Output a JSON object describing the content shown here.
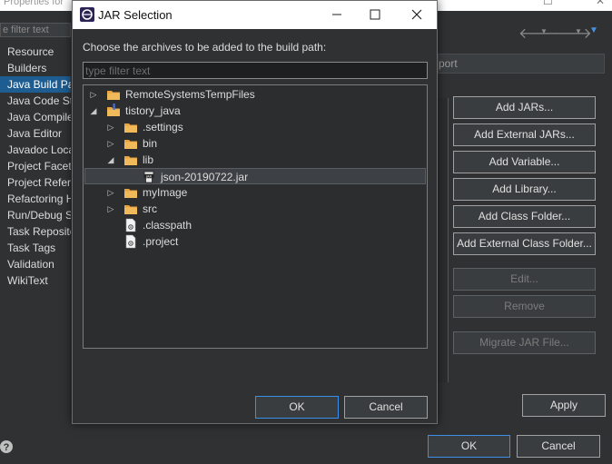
{
  "background": {
    "title": "Properties for",
    "filter_placeholder": "e filter text",
    "tab_stub": "port",
    "categories": [
      {
        "label": "Resource",
        "selected": false
      },
      {
        "label": "Builders",
        "selected": false
      },
      {
        "label": "Java Build Pa",
        "selected": true
      },
      {
        "label": "Java Code Sty",
        "selected": false
      },
      {
        "label": "Java Compile",
        "selected": false
      },
      {
        "label": "Java Editor",
        "selected": false
      },
      {
        "label": "Javadoc Loca",
        "selected": false
      },
      {
        "label": "Project Facets",
        "selected": false
      },
      {
        "label": "Project Refere",
        "selected": false
      },
      {
        "label": "Refactoring H",
        "selected": false
      },
      {
        "label": "Run/Debug S",
        "selected": false
      },
      {
        "label": "Task Reposito",
        "selected": false
      },
      {
        "label": "Task Tags",
        "selected": false
      },
      {
        "label": "Validation",
        "selected": false
      },
      {
        "label": "WikiText",
        "selected": false
      }
    ],
    "buttons": {
      "add_jars": "Add JARs...",
      "add_external_jars": "Add External JARs...",
      "add_variable": "Add Variable...",
      "add_library": "Add Library...",
      "add_class_folder": "Add Class Folder...",
      "add_external_class_folder": "Add External Class Folder...",
      "edit": "Edit...",
      "remove": "Remove",
      "migrate_jar": "Migrate JAR File...",
      "apply": "Apply",
      "ok": "OK",
      "cancel": "Cancel"
    }
  },
  "dialog": {
    "title": "JAR Selection",
    "message": "Choose the archives to be added to the build path:",
    "filter_placeholder": "type filter text",
    "tree": [
      {
        "label": "RemoteSystemsTempFiles",
        "icon": "project-folder-icon",
        "depth": 0,
        "expander": "collapsed"
      },
      {
        "label": "tistory_java",
        "icon": "java-project-icon",
        "depth": 0,
        "expander": "expanded"
      },
      {
        "label": ".settings",
        "icon": "folder-icon",
        "depth": 1,
        "expander": "collapsed"
      },
      {
        "label": "bin",
        "icon": "folder-icon",
        "depth": 1,
        "expander": "collapsed"
      },
      {
        "label": "lib",
        "icon": "folder-icon",
        "depth": 1,
        "expander": "expanded"
      },
      {
        "label": "json-20190722.jar",
        "icon": "jar-icon",
        "depth": 2,
        "expander": "none",
        "selected": true
      },
      {
        "label": "myImage",
        "icon": "folder-icon",
        "depth": 1,
        "expander": "collapsed"
      },
      {
        "label": "src",
        "icon": "folder-icon",
        "depth": 1,
        "expander": "collapsed"
      },
      {
        "label": ".classpath",
        "icon": "file-icon",
        "depth": 1,
        "expander": "none"
      },
      {
        "label": ".project",
        "icon": "file-icon",
        "depth": 1,
        "expander": "none"
      }
    ],
    "ok_label": "OK",
    "cancel_label": "Cancel"
  },
  "colors": {
    "selection": "#1e5d91",
    "focus_border": "#3d8ee6",
    "folder": "#e8a33d"
  }
}
